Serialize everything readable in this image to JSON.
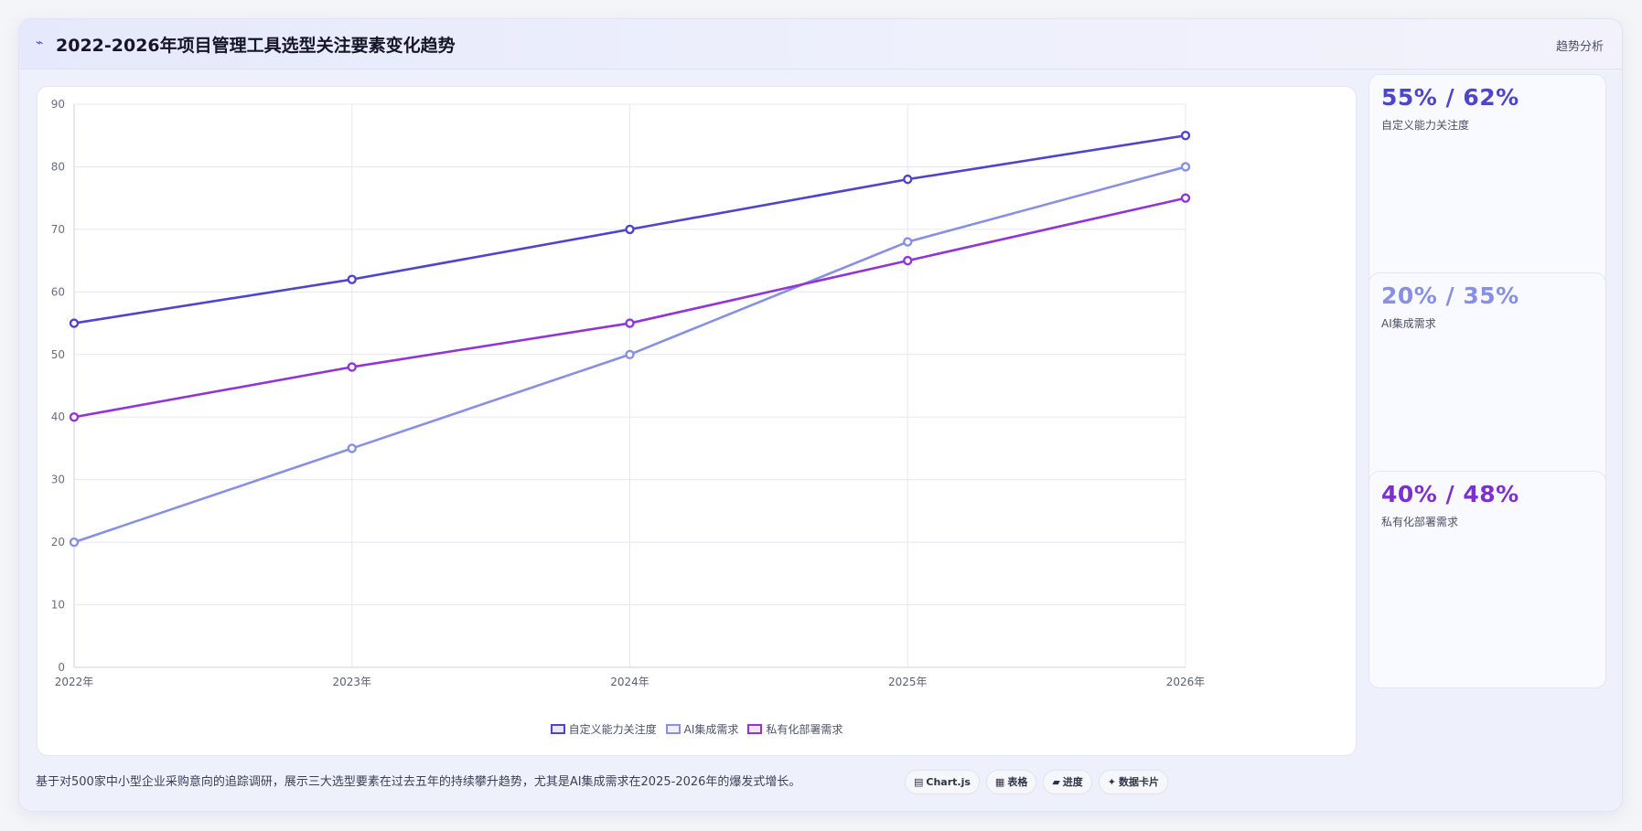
{
  "header": {
    "icon": "trend-line-icon",
    "title": "2022-2026年项目管理工具选型关注要素变化趋势",
    "tag": "趋势分析"
  },
  "chart_data": {
    "type": "line",
    "x": [
      "2022年",
      "2023年",
      "2024年",
      "2025年",
      "2026年"
    ],
    "ylim": [
      0,
      90
    ],
    "yticks": [
      0,
      10,
      20,
      30,
      40,
      50,
      60,
      70,
      80,
      90
    ],
    "grid": true,
    "legend_position": "bottom",
    "series": [
      {
        "name": "自定义能力关注度",
        "color": "#4f44cc",
        "values": [
          55,
          62,
          70,
          78,
          85
        ]
      },
      {
        "name": "AI集成需求",
        "color": "#8790e2",
        "values": [
          20,
          35,
          50,
          68,
          80
        ]
      },
      {
        "name": "私有化部署需求",
        "color": "#9135d6",
        "values": [
          40,
          48,
          55,
          65,
          75
        ]
      }
    ]
  },
  "stats": [
    {
      "value": "55% / 62%",
      "label": "自定义能力关注度",
      "color": "#4f44cc"
    },
    {
      "value": "20% / 35%",
      "label": "AI集成需求",
      "color": "#8790e2"
    },
    {
      "value": "40% / 48%",
      "label": "私有化部署需求",
      "color": "#7d2fd0"
    }
  ],
  "footer": {
    "note": "基于对500家中小型企业采购意向的追踪调研，展示三大选型要素在过去五年的持续攀升趋势，尤其是AI集成需求在2025-2026年的爆发式增长。",
    "chips": [
      {
        "icon": "chart-icon",
        "glyph": "▤",
        "label": "Chart.js"
      },
      {
        "icon": "table-icon",
        "glyph": "▦",
        "label": "表格"
      },
      {
        "icon": "progress-icon",
        "glyph": "▰",
        "label": "进度"
      },
      {
        "icon": "data-card-icon",
        "glyph": "✦",
        "label": "数据卡片"
      }
    ]
  }
}
